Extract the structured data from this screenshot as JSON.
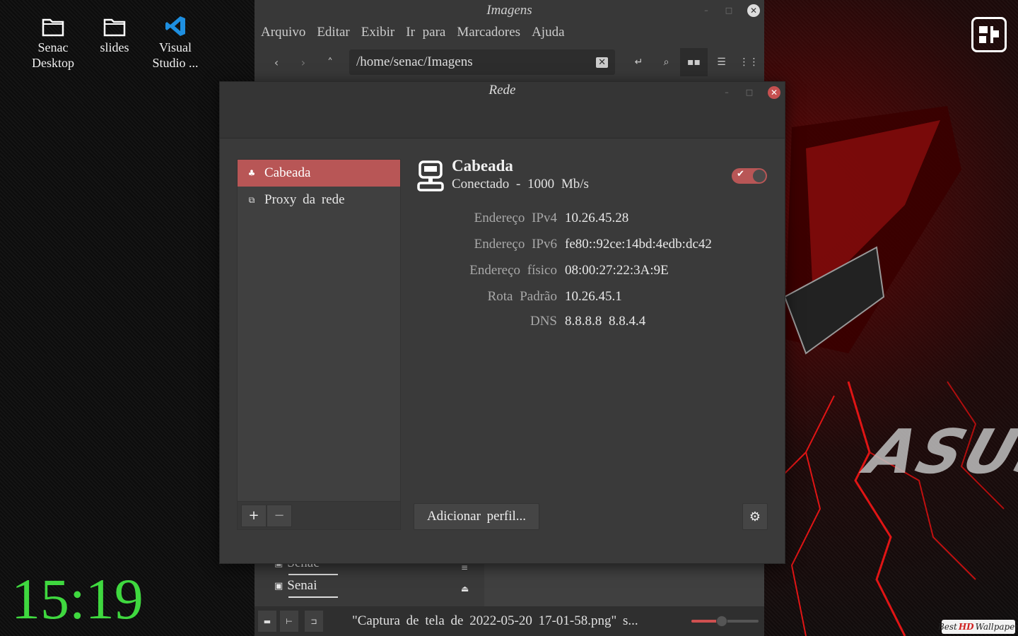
{
  "desktop": {
    "icons": [
      {
        "label_line1": "Senac",
        "label_line2": "Desktop",
        "icon": "folder-icon"
      },
      {
        "label_line1": "slides",
        "label_line2": "",
        "icon": "folder-icon"
      },
      {
        "label_line1": "Visual",
        "label_line2": "Studio ...",
        "icon": "vscode-icon"
      }
    ],
    "clock": "15:19",
    "watermark": {
      "text_a": "Best",
      "text_hd": "HD",
      "text_b": "Wallpaper"
    },
    "brand": "ASUS"
  },
  "file_manager": {
    "title": "Imagens",
    "menu": [
      "Arquivo",
      "Editar",
      "Exibir",
      "Ir para",
      "Marcadores",
      "Ajuda"
    ],
    "path": "/home/senac/Imagens",
    "sidebar": [
      {
        "label": "Senac",
        "icon": "drive-icon"
      },
      {
        "label": "Senai",
        "icon": "drive-icon"
      }
    ],
    "status_text": "\"Captura de tela de 2022-05-20 17-01-58.png\" s...",
    "zoom_level": 0.45
  },
  "network_dialog": {
    "title": "Rede",
    "connections": [
      {
        "label": "Cabeada",
        "icon": "wired-network-icon",
        "selected": true
      },
      {
        "label": "Proxy da rede",
        "icon": "proxy-icon",
        "selected": false
      }
    ],
    "add_label": "+",
    "remove_label": "−",
    "device": {
      "name": "Cabeada",
      "status": "Conectado - 1000 Mb/s",
      "enabled": true
    },
    "details": [
      {
        "key": "Endereço IPv4",
        "value": "10.26.45.28"
      },
      {
        "key": "Endereço IPv6",
        "value": "fe80::92ce:14bd:4edb:dc42"
      },
      {
        "key": "Endereço físico",
        "value": "08:00:27:22:3A:9E"
      },
      {
        "key": "Rota Padrão",
        "value": "10.26.45.1"
      },
      {
        "key": "DNS",
        "value": "8.8.8.8 8.8.4.4"
      }
    ],
    "add_profile_label": "Adicionar perfil...",
    "accent_color": "#b85656"
  }
}
